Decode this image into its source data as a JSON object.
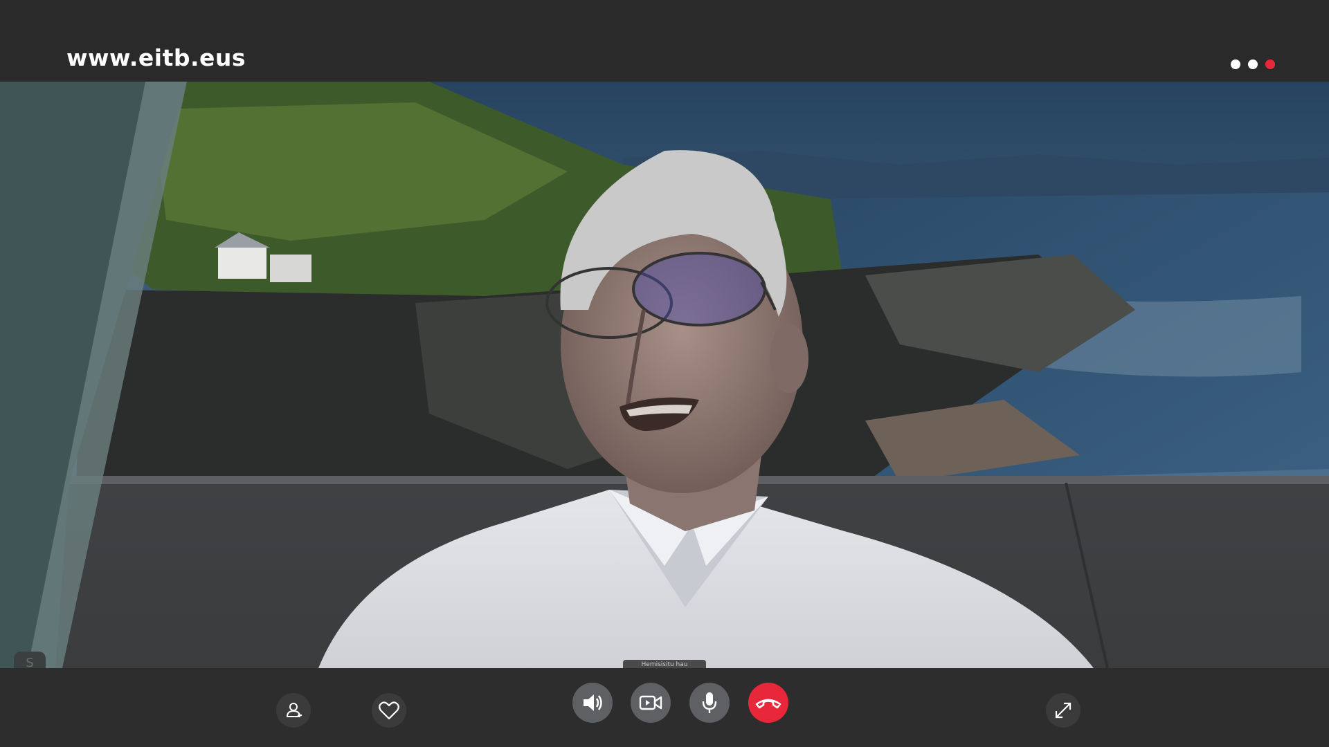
{
  "header": {
    "brand": "www.eitb.eus",
    "menu_dots_icon": "more-dots-icon",
    "dot_colors": [
      "#ffffff",
      "#ffffff",
      "#e8283a"
    ]
  },
  "video": {
    "description_icon": "video-feed",
    "caption_tab_text": "Hemisisitu hau"
  },
  "self_view": {
    "label": "S"
  },
  "controls": {
    "participants_icon": "participants-icon",
    "favorite_icon": "heart-icon",
    "speaker_icon": "speaker-icon",
    "camera_icon": "video-camera-icon",
    "microphone_icon": "microphone-icon",
    "end_call_icon": "hang-up-icon",
    "fullscreen_icon": "fullscreen-icon",
    "end_call_color": "#e8283a"
  }
}
